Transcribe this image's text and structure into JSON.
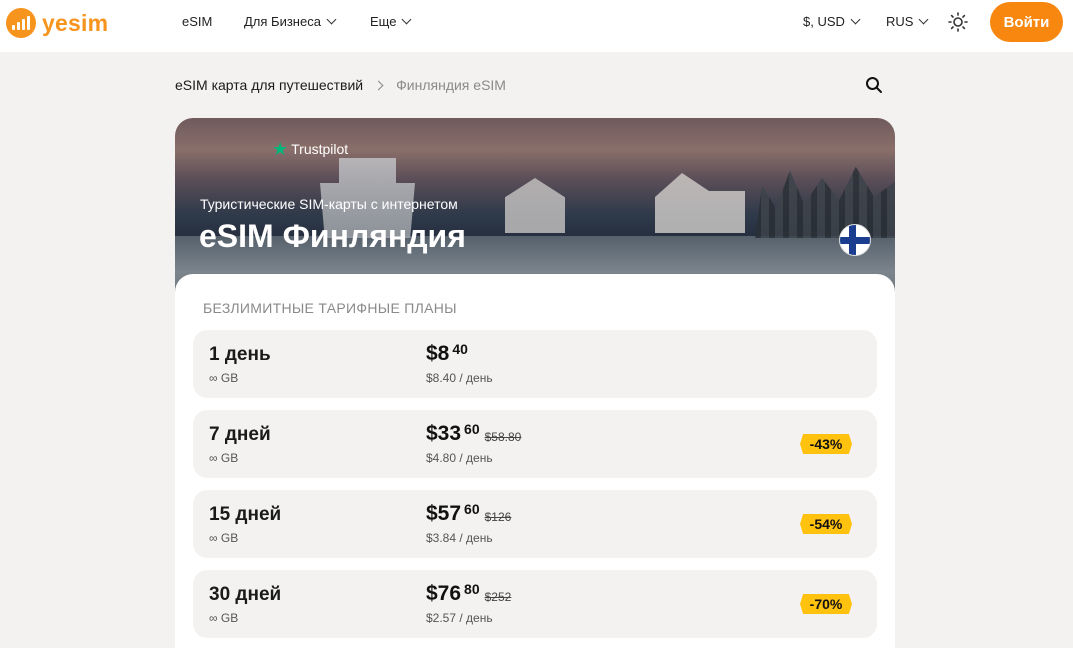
{
  "header": {
    "logo_text": "yesim",
    "nav": [
      "eSIM",
      "Для Бизнеса",
      "Еще"
    ],
    "currency": "$, USD",
    "language": "RUS",
    "login_label": "Войти"
  },
  "breadcrumb": {
    "parent": "eSIM карта для путешествий",
    "current": "Финляндия eSIM"
  },
  "hero": {
    "trustpilot": "Trustpilot",
    "subtitle": "Туристические SIM-карты с интернетом",
    "title": "eSIM Финляндия",
    "flag": "finland-flag"
  },
  "plans_section": {
    "title": "БЕЗЛИМИТНЫЕ ТАРИФНЫЕ ПЛАНЫ",
    "plans": [
      {
        "duration": "1 день",
        "data": "∞ GB",
        "price": "$8",
        "cents": "40",
        "old_price": "",
        "per_day": "$8.40 / день",
        "discount": ""
      },
      {
        "duration": "7 дней",
        "data": "∞ GB",
        "price": "$33",
        "cents": "60",
        "old_price": "$58.80",
        "per_day": "$4.80 / день",
        "discount": "-43%"
      },
      {
        "duration": "15 дней",
        "data": "∞ GB",
        "price": "$57",
        "cents": "60",
        "old_price": "$126",
        "per_day": "$3.84 / день",
        "discount": "-54%"
      },
      {
        "duration": "30 дней",
        "data": "∞ GB",
        "price": "$76",
        "cents": "80",
        "old_price": "$252",
        "per_day": "$2.57 / день",
        "discount": "-70%"
      }
    ]
  },
  "colors": {
    "brand_orange": "#f7941d",
    "button_orange": "#f7870f",
    "badge_yellow": "#ffc20e",
    "trustpilot_green": "#00b67a"
  }
}
